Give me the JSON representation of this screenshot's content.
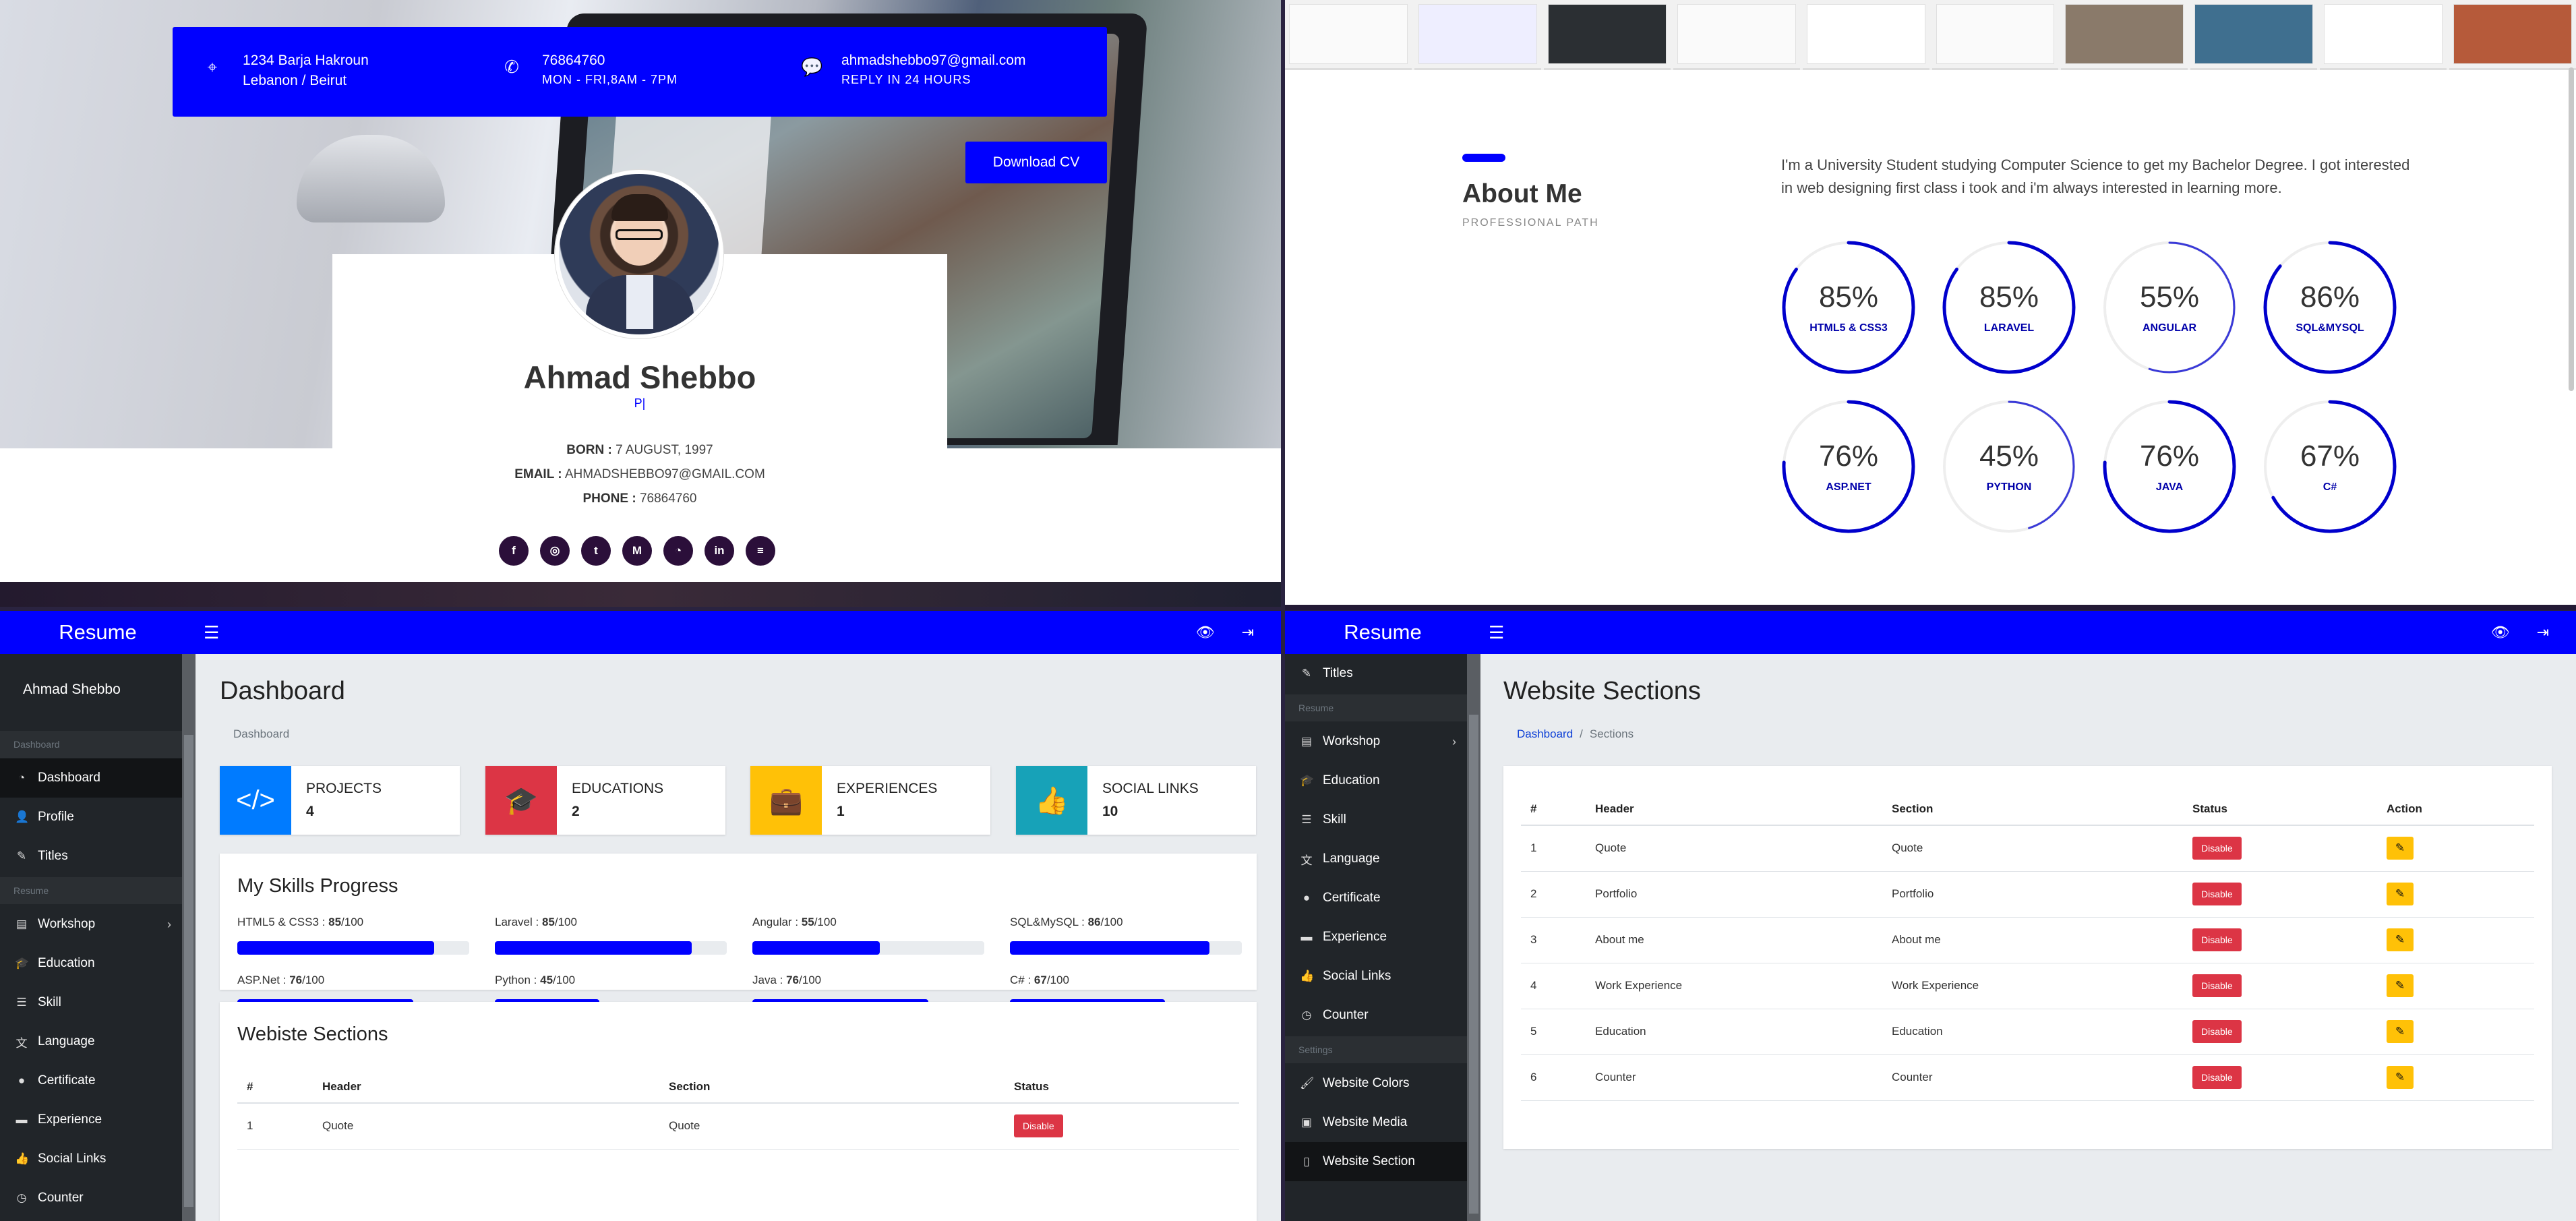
{
  "portfolio": {
    "contact": [
      {
        "icon": "map-pin-icon",
        "line1": "1234 Barja Hakroun",
        "line2": "Lebanon / Beirut"
      },
      {
        "icon": "phone-icon",
        "line1": "76864760",
        "line2": "MON - FRI,8AM - 7PM"
      },
      {
        "icon": "chat-icon",
        "line1": "ahmadshebbo97@gmail.com",
        "line2": "REPLY IN 24 HOURS"
      }
    ],
    "download_cv": "Download CV",
    "name": "Ahmad Shebbo",
    "typed_text": "P|",
    "born_label": "BORN :",
    "born_value": "7 AUGUST, 1997",
    "email_label": "EMAIL :",
    "email_value": "AHMADSHEBBO97@GMAIL.COM",
    "phone_label": "PHONE :",
    "phone_value": "76864760",
    "socials": [
      {
        "icon": "facebook-icon",
        "glyph": "f"
      },
      {
        "icon": "instagram-icon",
        "glyph": "◎"
      },
      {
        "icon": "twitter-icon",
        "glyph": "t"
      },
      {
        "icon": "medium-icon",
        "glyph": "M"
      },
      {
        "icon": "github-icon",
        "glyph": "◔"
      },
      {
        "icon": "linkedin-icon",
        "glyph": "in"
      },
      {
        "icon": "stackoverflow-icon",
        "glyph": "≡"
      }
    ]
  },
  "about": {
    "title": "About Me",
    "subtitle": "PROFESSIONAL PATH",
    "text": "I'm a University Student studying Computer Science to get my Bachelor Degree. I got interested in web designing first class i took and i'm always interested in learning more.",
    "skills": [
      {
        "label": "HTML5 & CSS3",
        "pct": "85%",
        "value": 85
      },
      {
        "label": "LARAVEL",
        "pct": "85%",
        "value": 85
      },
      {
        "label": "ANGULAR",
        "pct": "55%",
        "value": 55
      },
      {
        "label": "SQL&MYSQL",
        "pct": "86%",
        "value": 86
      },
      {
        "label": "ASP.NET",
        "pct": "76%",
        "value": 76
      },
      {
        "label": "PYTHON",
        "pct": "45%",
        "value": 45
      },
      {
        "label": "JAVA",
        "pct": "76%",
        "value": 76
      },
      {
        "label": "C#",
        "pct": "67%",
        "value": 67
      }
    ],
    "ring_color": "#0000cc"
  },
  "admin": {
    "brand": "Resume",
    "user": "Ahmad Shebbo",
    "sidebar": {
      "heading_dashboard": "Dashboard",
      "heading_resume": "Resume",
      "heading_settings": "Settings",
      "dashboard": "Dashboard",
      "profile": "Profile",
      "titles": "Titles",
      "workshop": "Workshop",
      "education": "Education",
      "skill": "Skill",
      "language": "Language",
      "certificate": "Certificate",
      "experience": "Experience",
      "social_links": "Social Links",
      "counter": "Counter",
      "website_colors": "Website Colors",
      "website_media": "Website Media",
      "website_section": "Website Section"
    },
    "dashboard": {
      "title": "Dashboard",
      "breadcrumb": "Dashboard",
      "stats": [
        {
          "label": "PROJECTS",
          "value": "4",
          "color": "#007bff",
          "icon": "code-icon",
          "glyph": "</>"
        },
        {
          "label": "EDUCATIONS",
          "value": "2",
          "color": "#dc3545",
          "icon": "graduation-cap-icon",
          "glyph": "🎓"
        },
        {
          "label": "EXPERIENCES",
          "value": "1",
          "color": "#ffc107",
          "icon": "briefcase-icon",
          "glyph": "💼"
        },
        {
          "label": "SOCIAL LINKS",
          "value": "10",
          "color": "#17a2b8",
          "icon": "thumbs-up-icon",
          "glyph": "👍"
        }
      ],
      "skills_title": "My Skills Progress",
      "skills": [
        {
          "name": "HTML5 & CSS3",
          "score": "85",
          "of": "/100",
          "value": 85
        },
        {
          "name": "Laravel",
          "score": "85",
          "of": "/100",
          "value": 85
        },
        {
          "name": "Angular",
          "score": "55",
          "of": "/100",
          "value": 55
        },
        {
          "name": "SQL&MySQL",
          "score": "86",
          "of": "/100",
          "value": 86
        },
        {
          "name": "ASP.Net",
          "score": "76",
          "of": "/100",
          "value": 76
        },
        {
          "name": "Python",
          "score": "45",
          "of": "/100",
          "value": 45
        },
        {
          "name": "Java",
          "score": "76",
          "of": "/100",
          "value": 76
        },
        {
          "name": "C#",
          "score": "67",
          "of": "/100",
          "value": 67
        }
      ],
      "sections_title": "Webiste Sections",
      "table_headers": [
        "#",
        "Header",
        "Section",
        "Status"
      ],
      "rows": [
        {
          "n": "1",
          "header": "Quote",
          "section": "Quote",
          "status": "Disable"
        }
      ]
    },
    "sections": {
      "title": "Website Sections",
      "breadcrumb_home": "Dashboard",
      "breadcrumb_sep": "/",
      "breadcrumb_current": "Sections",
      "table_headers": [
        "#",
        "Header",
        "Section",
        "Status",
        "Action"
      ],
      "rows": [
        {
          "n": "1",
          "header": "Quote",
          "section": "Quote",
          "status": "Disable"
        },
        {
          "n": "2",
          "header": "Portfolio",
          "section": "Portfolio",
          "status": "Disable"
        },
        {
          "n": "3",
          "header": "About me",
          "section": "About me",
          "status": "Disable"
        },
        {
          "n": "4",
          "header": "Work Experience",
          "section": "Work Experience",
          "status": "Disable"
        },
        {
          "n": "5",
          "header": "Education",
          "section": "Education",
          "status": "Disable"
        },
        {
          "n": "6",
          "header": "Counter",
          "section": "Counter",
          "status": "Disable"
        }
      ]
    }
  }
}
